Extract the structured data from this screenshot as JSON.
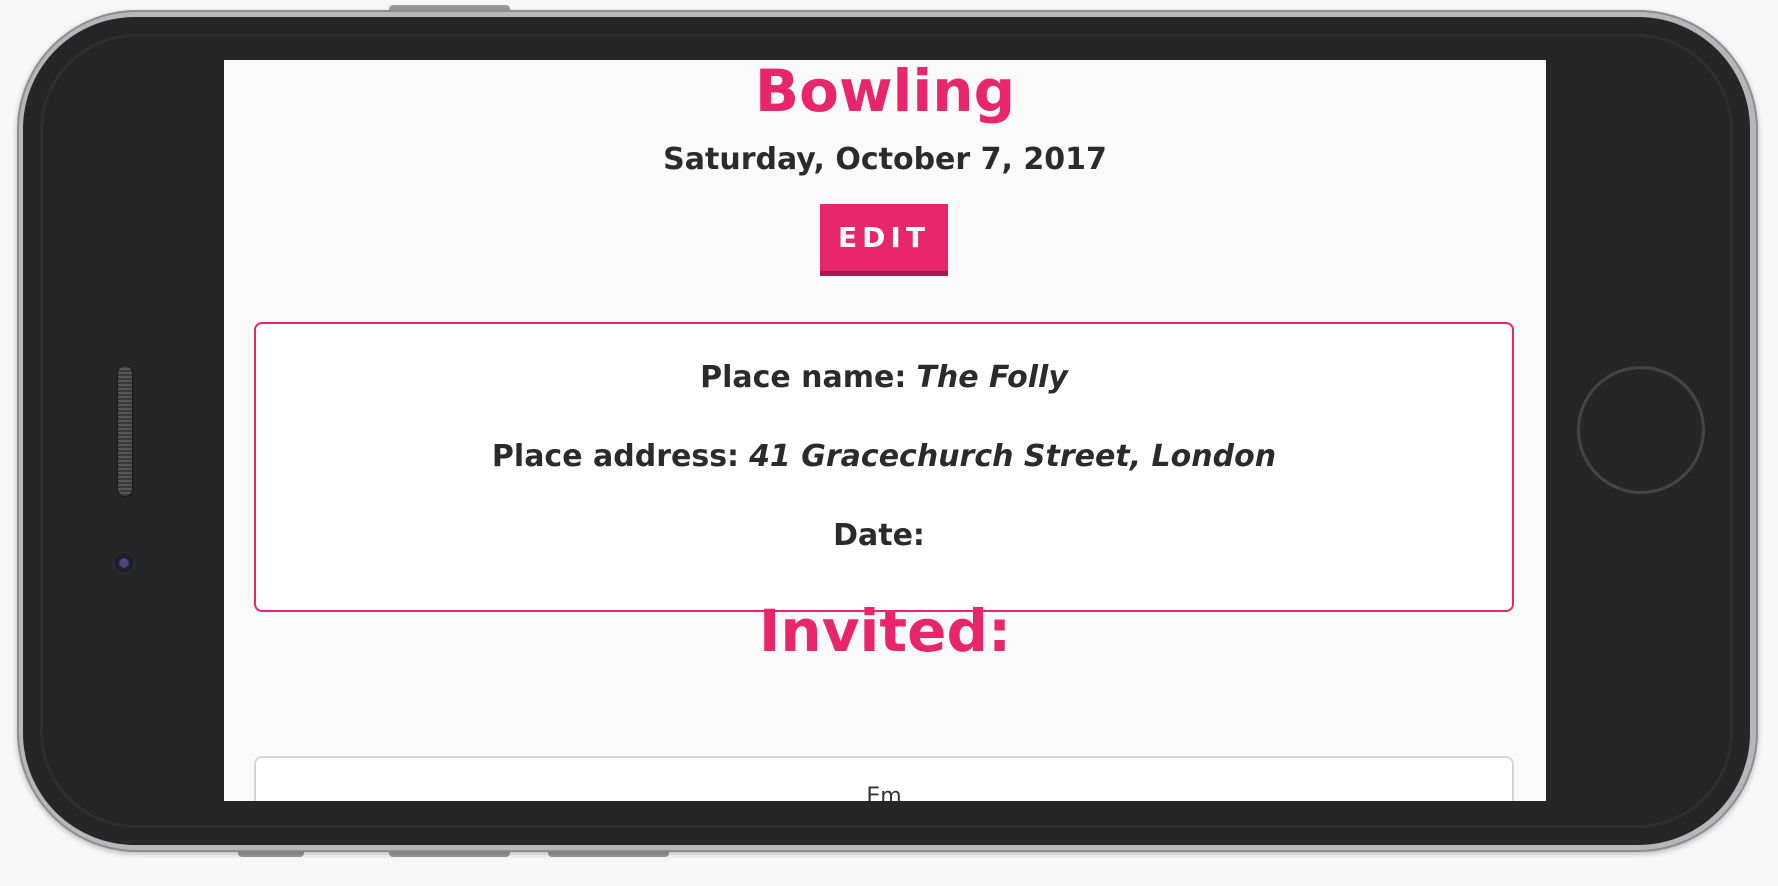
{
  "event": {
    "title": "Bowling",
    "date": "Saturday, October 7, 2017",
    "edit_label": "EDIT"
  },
  "details": {
    "place_name_label": "Place name:",
    "place_name_value": "The Folly",
    "place_address_label": "Place address:",
    "place_address_value": "41 Gracechurch Street, London",
    "date_label": "Date:",
    "date_value": ""
  },
  "invited": {
    "title": "Invited:",
    "items": [
      {
        "name": "Em"
      }
    ]
  },
  "colors": {
    "accent": "#e8266b",
    "text": "#2b2b2b",
    "background": "#fafafa",
    "phone_body": "#262626"
  }
}
